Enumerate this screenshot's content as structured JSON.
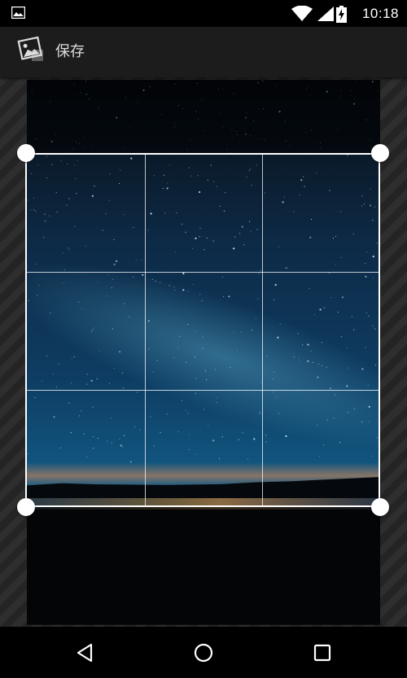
{
  "status_bar": {
    "notification_icon": "image-icon",
    "wifi_icon": "wifi-icon",
    "signal_icon": "signal-icon",
    "battery_icon": "battery-charging-icon",
    "time": "10:18"
  },
  "action_bar": {
    "app_icon": "photo-editor-icon",
    "save_label": "保存"
  },
  "crop": {
    "grid": "3x3",
    "handles": [
      "top-left",
      "top-right",
      "bottom-left",
      "bottom-right"
    ]
  },
  "nav_bar": {
    "back_icon": "back-triangle-icon",
    "home_icon": "home-circle-icon",
    "recents_icon": "recents-square-icon"
  },
  "colors": {
    "status_bar_bg": "#000000",
    "action_bar_bg": "#1c1c1c",
    "crop_border": "#ffffff"
  }
}
